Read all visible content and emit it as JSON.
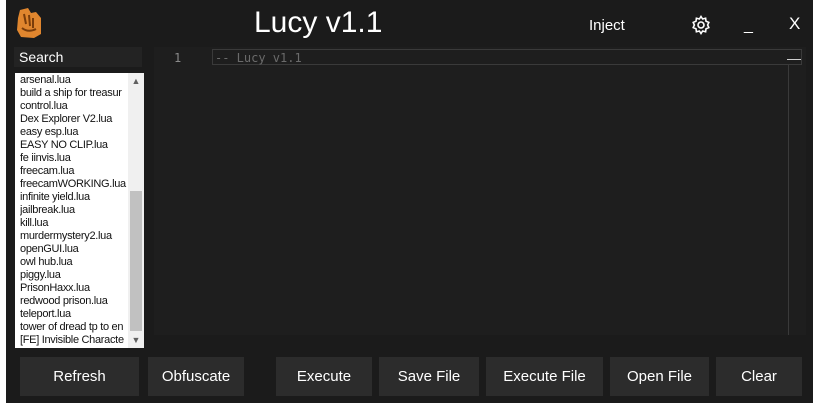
{
  "app": {
    "title": "Lucy v1.1"
  },
  "titlebar": {
    "inject_label": "Inject",
    "minimize_label": "_",
    "close_label": "X"
  },
  "search": {
    "label": "Search"
  },
  "scripts": [
    "arsenal.lua",
    "build a ship for treasur",
    "control.lua",
    "Dex Explorer V2.lua",
    "easy esp.lua",
    "EASY NO CLIP.lua",
    "fe iinvis.lua",
    "freecam.lua",
    "freecamWORKING.lua",
    "infinite yield.lua",
    "jailbreak.lua",
    "kill.lua",
    "murdermystery2.lua",
    "openGUI.lua",
    "owl hub.lua",
    "piggy.lua",
    "PrisonHaxx.lua",
    "redwood prison.lua",
    "teleport.lua",
    "tower of dread tp to en",
    "[FE] Invisible Characte"
  ],
  "editor": {
    "line_number": "1",
    "code": "-- Lucy v1.1"
  },
  "buttons": {
    "refresh": "Refresh",
    "obfuscate": "Obfuscate",
    "execute": "Execute",
    "save_file": "Save File",
    "execute_file": "Execute File",
    "open_file": "Open File",
    "clear": "Clear"
  },
  "colors": {
    "background": "#1b1b1b",
    "logo": "#e0862e",
    "button": "#2c2c2c"
  },
  "icons": {
    "logo": "bottle-hand-logo-icon",
    "settings": "gear-icon"
  }
}
